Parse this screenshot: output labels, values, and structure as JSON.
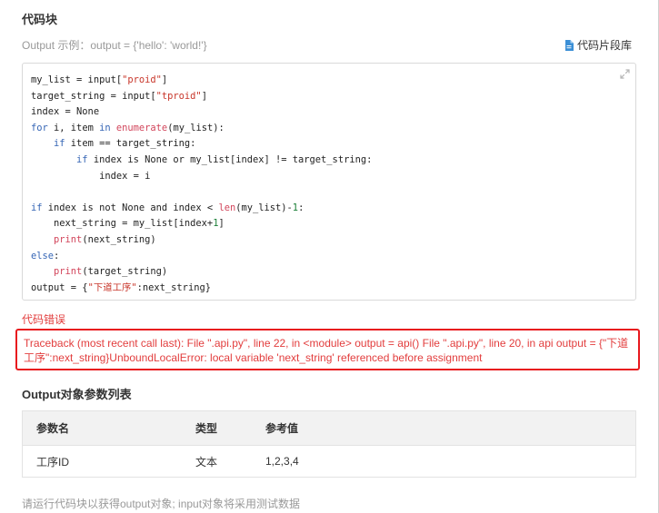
{
  "section": {
    "title": "代码块"
  },
  "output_example": {
    "label": "Output 示例：output = {'hello': 'world!'}"
  },
  "snippet_library": {
    "label": "代码片段库"
  },
  "code": {
    "lines": [
      [
        {
          "t": "my_list = input["
        },
        {
          "t": "\"proid\"",
          "c": "str"
        },
        {
          "t": "]"
        }
      ],
      [
        {
          "t": "target_string = input["
        },
        {
          "t": "\"tproid\"",
          "c": "str"
        },
        {
          "t": "]"
        }
      ],
      [
        {
          "t": "index = None"
        }
      ],
      [
        {
          "t": "for",
          "c": "kw"
        },
        {
          "t": " i, item "
        },
        {
          "t": "in",
          "c": "kw"
        },
        {
          "t": " "
        },
        {
          "t": "enumerate",
          "c": "fn"
        },
        {
          "t": "(my_list):"
        }
      ],
      [
        {
          "t": "    "
        },
        {
          "t": "if",
          "c": "kw"
        },
        {
          "t": " item == target_string:"
        }
      ],
      [
        {
          "t": "        "
        },
        {
          "t": "if",
          "c": "kw"
        },
        {
          "t": " index is None or my_list[index] != target_string:"
        }
      ],
      [
        {
          "t": "            index = i"
        }
      ],
      [
        {
          "t": ""
        }
      ],
      [
        {
          "t": "if",
          "c": "kw"
        },
        {
          "t": " index is not None and index < "
        },
        {
          "t": "len",
          "c": "fn"
        },
        {
          "t": "(my_list)-"
        },
        {
          "t": "1",
          "c": "num"
        },
        {
          "t": ":"
        }
      ],
      [
        {
          "t": "    next_string = my_list[index+"
        },
        {
          "t": "1",
          "c": "num"
        },
        {
          "t": "]"
        }
      ],
      [
        {
          "t": "    "
        },
        {
          "t": "print",
          "c": "fn"
        },
        {
          "t": "(next_string)"
        }
      ],
      [
        {
          "t": "else",
          "c": "kw"
        },
        {
          "t": ":"
        }
      ],
      [
        {
          "t": "    "
        },
        {
          "t": "print",
          "c": "fn"
        },
        {
          "t": "(target_string)"
        }
      ],
      [
        {
          "t": "output = {"
        },
        {
          "t": "\"下道工序\"",
          "c": "str"
        },
        {
          "t": ":next_string}"
        }
      ]
    ]
  },
  "error": {
    "title": "代码错误",
    "message": "Traceback (most recent call last): File \".api.py\", line 22, in <module> output = api() File \".api.py\", line 20, in api output = {\"下道工序\":next_string}UnboundLocalError: local variable 'next_string' referenced before assignment"
  },
  "params": {
    "title": "Output对象参数列表",
    "headers": [
      "参数名",
      "类型",
      "参考值"
    ],
    "rows": [
      [
        "工序ID",
        "文本",
        "1,2,3,4"
      ]
    ]
  },
  "footer": {
    "note": "请运行代码块以获得output对象; input对象将采用测试数据"
  },
  "colors": {
    "error": "#e23d3d",
    "error_border": "#e8191e",
    "keyword": "#3565b5",
    "string": "#c8362a"
  },
  "icons": {
    "snippet": "document-icon",
    "expand": "expand-icon"
  }
}
